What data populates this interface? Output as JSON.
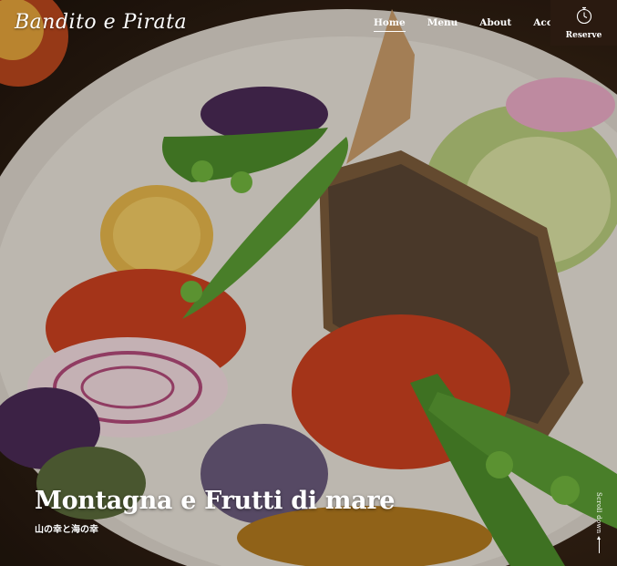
{
  "brand": {
    "logo_text": "Bandito e Pirata"
  },
  "nav": {
    "items": [
      {
        "label": "Home",
        "active": true
      },
      {
        "label": "Menu",
        "active": false
      },
      {
        "label": "About",
        "active": false
      },
      {
        "label": "Access",
        "active": false
      }
    ]
  },
  "reserve": {
    "label": "Reserve",
    "icon": "clock-icon"
  },
  "hero": {
    "title": "Montagna e Frutti di mare",
    "subtitle": "山の幸と海の幸"
  },
  "scroll": {
    "label": "Scroll down",
    "icon": "arrow-up-icon"
  }
}
